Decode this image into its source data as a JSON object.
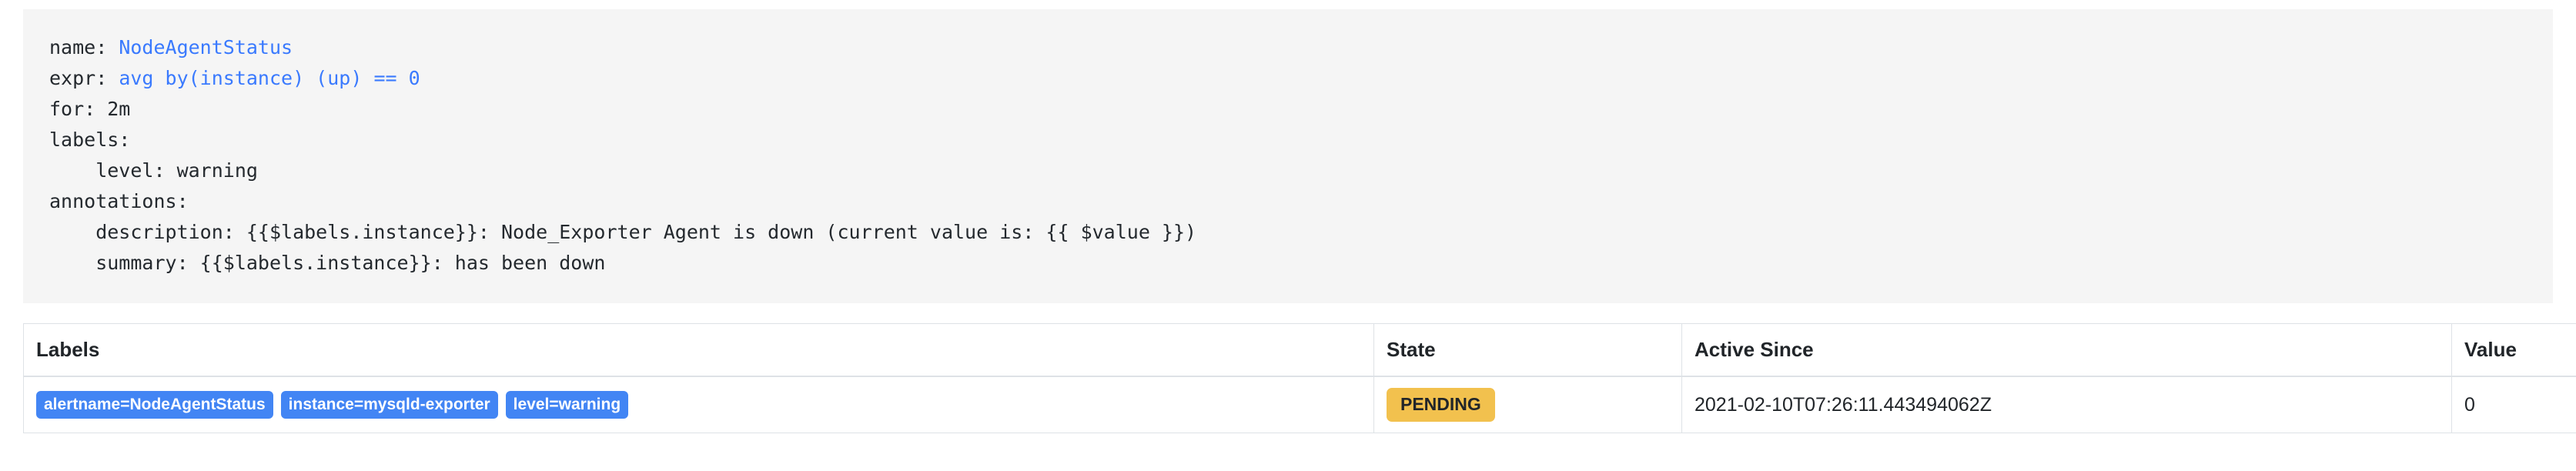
{
  "rule": {
    "lines": [
      {
        "key": "name: ",
        "value": "NodeAgentStatus",
        "highlight": true
      },
      {
        "key": "expr: ",
        "value": "avg by(instance) (up) == 0",
        "highlight": true
      },
      {
        "key": "for: 2m",
        "value": "",
        "highlight": false
      },
      {
        "key": "labels:",
        "value": "",
        "highlight": false
      },
      {
        "key": "    level: warning",
        "value": "",
        "highlight": false
      },
      {
        "key": "annotations:",
        "value": "",
        "highlight": false
      },
      {
        "key": "    description: {{$labels.instance}}: Node_Exporter Agent is down (current value is: {{ $value }})",
        "value": "",
        "highlight": false
      },
      {
        "key": "    summary: {{$labels.instance}}: has been down",
        "value": "",
        "highlight": false
      }
    ],
    "name_key": "name: ",
    "name_value": "NodeAgentStatus",
    "expr_key": "expr: ",
    "expr_value": "avg by(instance) (up) == 0",
    "for_line": "for: 2m",
    "labels_line": "labels:",
    "level_line": "    level: warning",
    "annotations_line": "annotations:",
    "description_line": "    description: {{$labels.instance}}: Node_Exporter Agent is down (current value is: {{ $value }})",
    "summary_line": "    summary: {{$labels.instance}}: has been down"
  },
  "table": {
    "headers": {
      "labels": "Labels",
      "state": "State",
      "active_since": "Active Since",
      "value": "Value"
    },
    "rows": [
      {
        "labels": [
          "alertname=NodeAgentStatus",
          "instance=mysqld-exporter",
          "level=warning"
        ],
        "state": "PENDING",
        "active_since": "2021-02-10T07:26:11.443494062Z",
        "value": "0"
      }
    ]
  },
  "colors": {
    "badge_label_bg": "#4285f4",
    "badge_pending_bg": "#f2c14e",
    "block_bg": "#f5f5f5",
    "expr_text": "#3a7afe",
    "border": "#dee2e6"
  }
}
